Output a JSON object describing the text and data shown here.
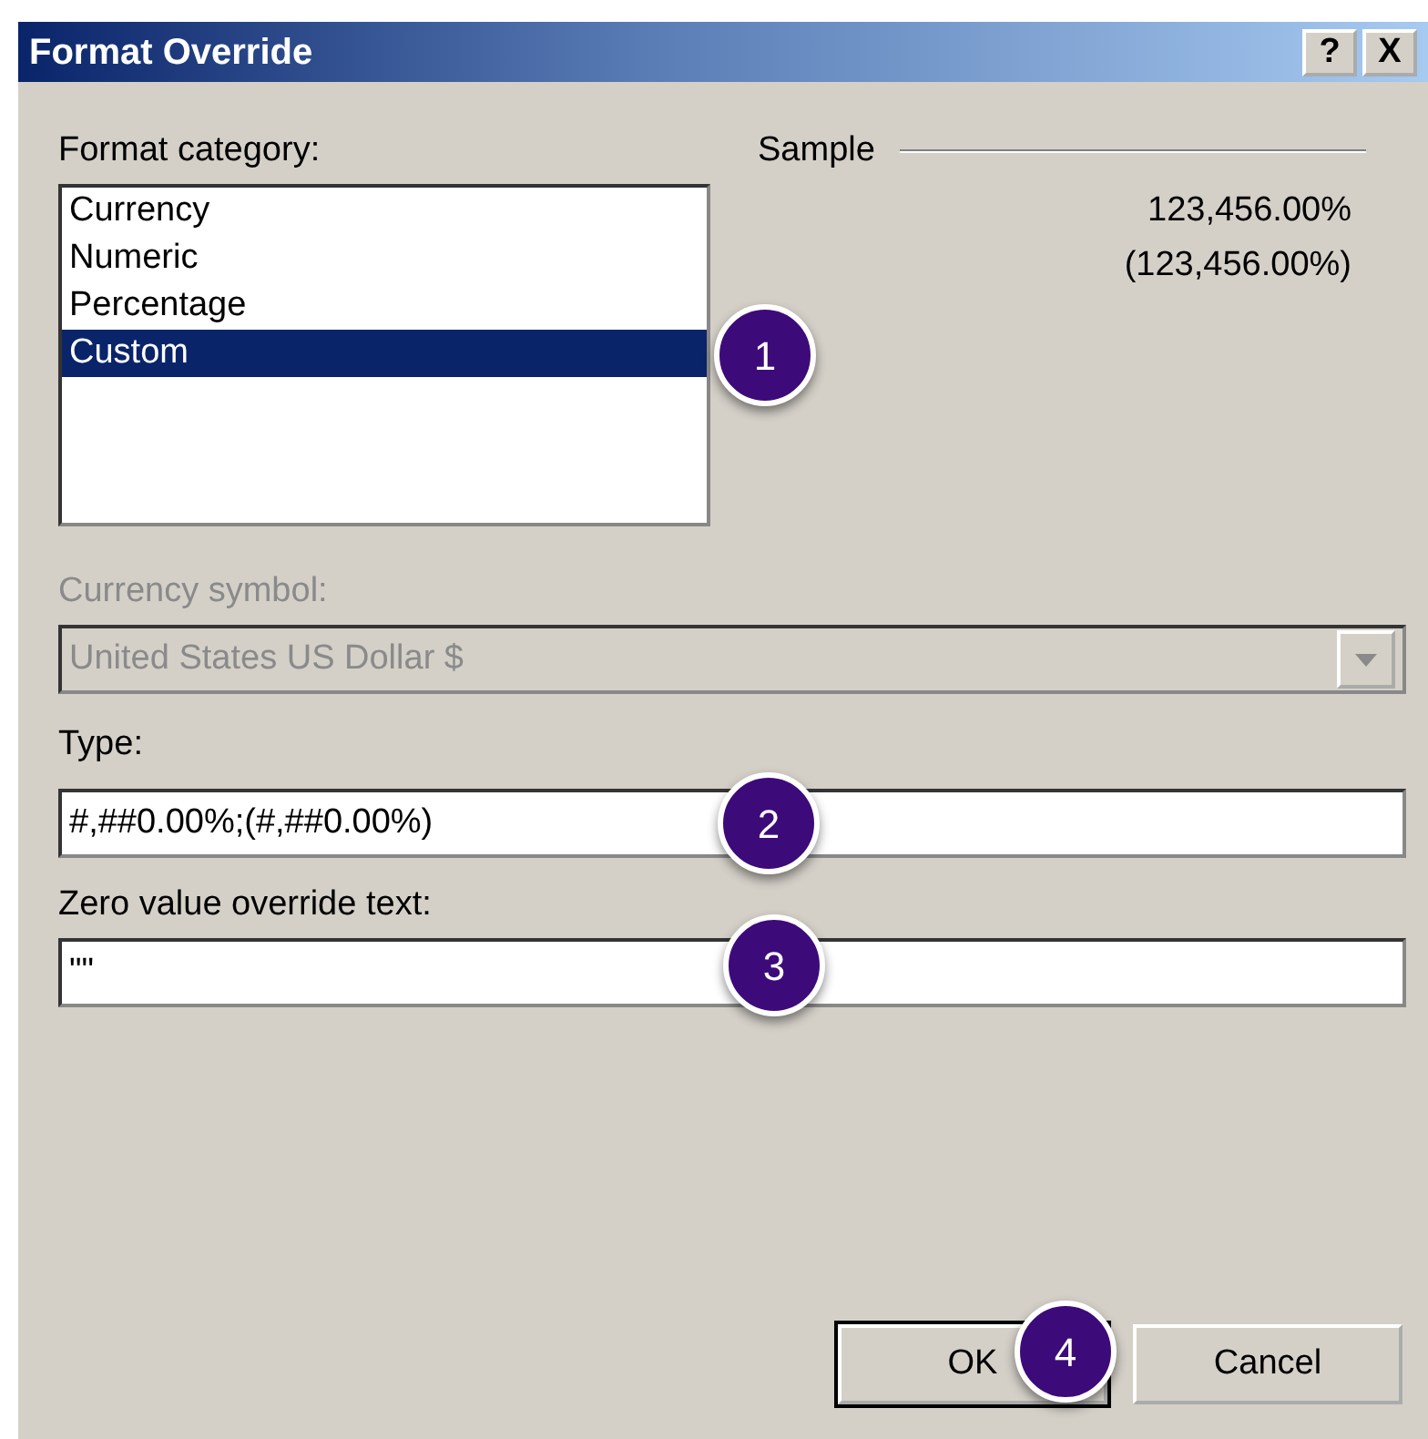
{
  "window": {
    "title": "Format Override",
    "buttons": [
      {
        "label": "?"
      },
      {
        "label": "X"
      }
    ]
  },
  "format_category": {
    "label": "Format category:",
    "items": [
      {
        "label": "Currency",
        "selected": false
      },
      {
        "label": "Numeric",
        "selected": false
      },
      {
        "label": "Percentage",
        "selected": false
      },
      {
        "label": "Custom",
        "selected": true
      }
    ]
  },
  "sample": {
    "label": "Sample",
    "lines": [
      "123,456.00%",
      "(123,456.00%)"
    ]
  },
  "currency_symbol": {
    "label": "Currency symbol:",
    "value": "United States US Dollar $",
    "disabled": true
  },
  "type": {
    "label": "Type:",
    "value": "#,##0.00%;(#,##0.00%)"
  },
  "zero_value": {
    "label": "Zero value override text:",
    "value": "\"\""
  },
  "buttons": [
    {
      "label": "OK",
      "default": true
    },
    {
      "label": "Cancel",
      "default": false
    }
  ],
  "callouts": [
    "1",
    "2",
    "3",
    "4"
  ]
}
